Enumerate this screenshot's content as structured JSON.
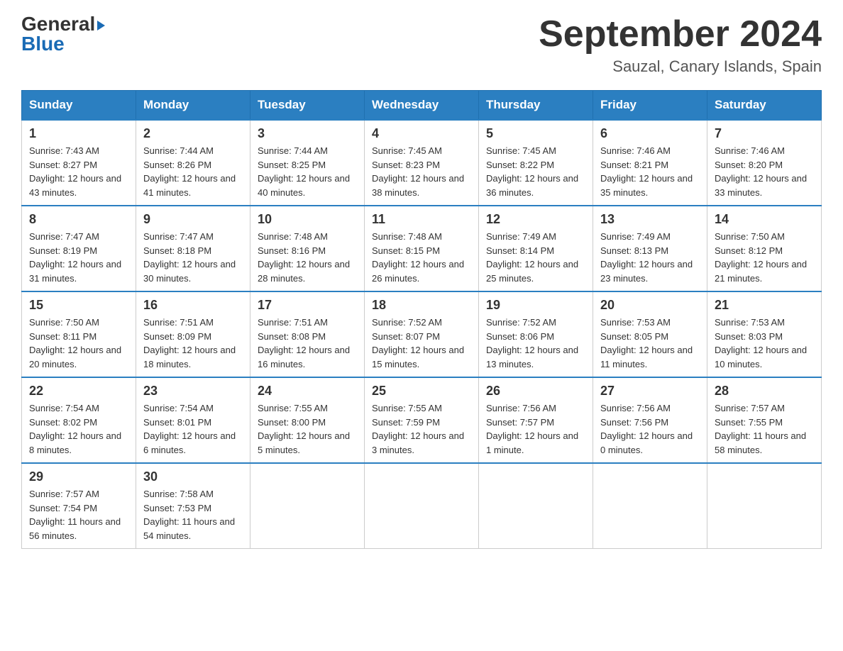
{
  "header": {
    "logo_text1": "General",
    "logo_text2": "Blue",
    "month_year": "September 2024",
    "location": "Sauzal, Canary Islands, Spain"
  },
  "days_of_week": [
    "Sunday",
    "Monday",
    "Tuesday",
    "Wednesday",
    "Thursday",
    "Friday",
    "Saturday"
  ],
  "weeks": [
    [
      {
        "day": "1",
        "sunrise": "7:43 AM",
        "sunset": "8:27 PM",
        "daylight": "12 hours and 43 minutes."
      },
      {
        "day": "2",
        "sunrise": "7:44 AM",
        "sunset": "8:26 PM",
        "daylight": "12 hours and 41 minutes."
      },
      {
        "day": "3",
        "sunrise": "7:44 AM",
        "sunset": "8:25 PM",
        "daylight": "12 hours and 40 minutes."
      },
      {
        "day": "4",
        "sunrise": "7:45 AM",
        "sunset": "8:23 PM",
        "daylight": "12 hours and 38 minutes."
      },
      {
        "day": "5",
        "sunrise": "7:45 AM",
        "sunset": "8:22 PM",
        "daylight": "12 hours and 36 minutes."
      },
      {
        "day": "6",
        "sunrise": "7:46 AM",
        "sunset": "8:21 PM",
        "daylight": "12 hours and 35 minutes."
      },
      {
        "day": "7",
        "sunrise": "7:46 AM",
        "sunset": "8:20 PM",
        "daylight": "12 hours and 33 minutes."
      }
    ],
    [
      {
        "day": "8",
        "sunrise": "7:47 AM",
        "sunset": "8:19 PM",
        "daylight": "12 hours and 31 minutes."
      },
      {
        "day": "9",
        "sunrise": "7:47 AM",
        "sunset": "8:18 PM",
        "daylight": "12 hours and 30 minutes."
      },
      {
        "day": "10",
        "sunrise": "7:48 AM",
        "sunset": "8:16 PM",
        "daylight": "12 hours and 28 minutes."
      },
      {
        "day": "11",
        "sunrise": "7:48 AM",
        "sunset": "8:15 PM",
        "daylight": "12 hours and 26 minutes."
      },
      {
        "day": "12",
        "sunrise": "7:49 AM",
        "sunset": "8:14 PM",
        "daylight": "12 hours and 25 minutes."
      },
      {
        "day": "13",
        "sunrise": "7:49 AM",
        "sunset": "8:13 PM",
        "daylight": "12 hours and 23 minutes."
      },
      {
        "day": "14",
        "sunrise": "7:50 AM",
        "sunset": "8:12 PM",
        "daylight": "12 hours and 21 minutes."
      }
    ],
    [
      {
        "day": "15",
        "sunrise": "7:50 AM",
        "sunset": "8:11 PM",
        "daylight": "12 hours and 20 minutes."
      },
      {
        "day": "16",
        "sunrise": "7:51 AM",
        "sunset": "8:09 PM",
        "daylight": "12 hours and 18 minutes."
      },
      {
        "day": "17",
        "sunrise": "7:51 AM",
        "sunset": "8:08 PM",
        "daylight": "12 hours and 16 minutes."
      },
      {
        "day": "18",
        "sunrise": "7:52 AM",
        "sunset": "8:07 PM",
        "daylight": "12 hours and 15 minutes."
      },
      {
        "day": "19",
        "sunrise": "7:52 AM",
        "sunset": "8:06 PM",
        "daylight": "12 hours and 13 minutes."
      },
      {
        "day": "20",
        "sunrise": "7:53 AM",
        "sunset": "8:05 PM",
        "daylight": "12 hours and 11 minutes."
      },
      {
        "day": "21",
        "sunrise": "7:53 AM",
        "sunset": "8:03 PM",
        "daylight": "12 hours and 10 minutes."
      }
    ],
    [
      {
        "day": "22",
        "sunrise": "7:54 AM",
        "sunset": "8:02 PM",
        "daylight": "12 hours and 8 minutes."
      },
      {
        "day": "23",
        "sunrise": "7:54 AM",
        "sunset": "8:01 PM",
        "daylight": "12 hours and 6 minutes."
      },
      {
        "day": "24",
        "sunrise": "7:55 AM",
        "sunset": "8:00 PM",
        "daylight": "12 hours and 5 minutes."
      },
      {
        "day": "25",
        "sunrise": "7:55 AM",
        "sunset": "7:59 PM",
        "daylight": "12 hours and 3 minutes."
      },
      {
        "day": "26",
        "sunrise": "7:56 AM",
        "sunset": "7:57 PM",
        "daylight": "12 hours and 1 minute."
      },
      {
        "day": "27",
        "sunrise": "7:56 AM",
        "sunset": "7:56 PM",
        "daylight": "12 hours and 0 minutes."
      },
      {
        "day": "28",
        "sunrise": "7:57 AM",
        "sunset": "7:55 PM",
        "daylight": "11 hours and 58 minutes."
      }
    ],
    [
      {
        "day": "29",
        "sunrise": "7:57 AM",
        "sunset": "7:54 PM",
        "daylight": "11 hours and 56 minutes."
      },
      {
        "day": "30",
        "sunrise": "7:58 AM",
        "sunset": "7:53 PM",
        "daylight": "11 hours and 54 minutes."
      },
      null,
      null,
      null,
      null,
      null
    ]
  ]
}
